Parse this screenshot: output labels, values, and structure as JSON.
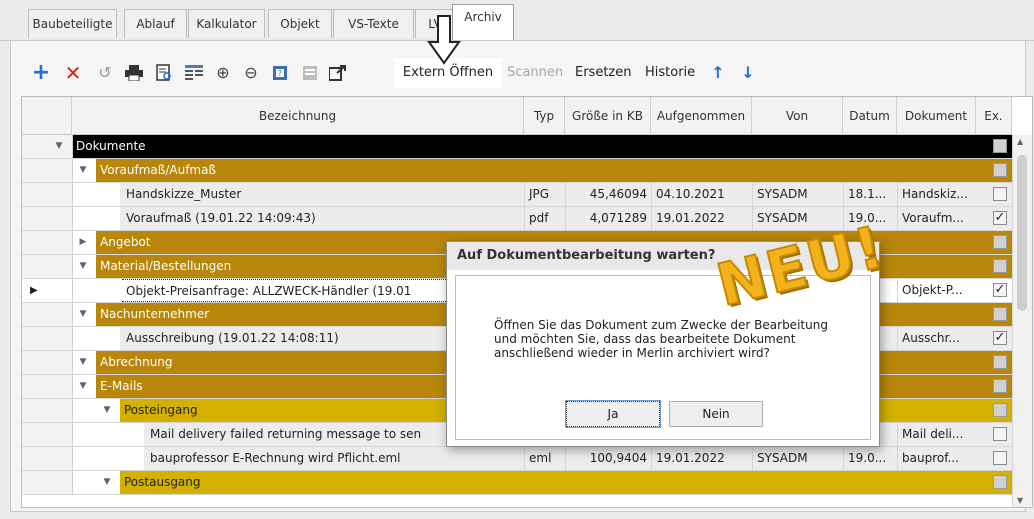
{
  "tabs": [
    {
      "label": "Baubeteiligte"
    },
    {
      "label": "Ablauf"
    },
    {
      "label": "Kalkulator"
    },
    {
      "label": "Objekt"
    },
    {
      "label": "VS-Texte"
    },
    {
      "label": "LV"
    },
    {
      "label": "Archiv",
      "active": true
    }
  ],
  "toolbar": {
    "extern_label": "Extern Öffnen",
    "scannen_label": "Scannen",
    "ersetzen_label": "Ersetzen",
    "historie_label": "Historie",
    "icons": [
      "add-icon",
      "delete-icon",
      "undo-icon",
      "print-icon",
      "preview-icon",
      "list-icon",
      "zoom-in-icon",
      "zoom-out-icon",
      "note-icon",
      "disabled-doc-icon",
      "export-icon",
      "move-up-icon",
      "move-down-icon"
    ]
  },
  "grid": {
    "columns": [
      "Bezeichnung",
      "Typ",
      "Größe in KB",
      "Aufgenommen",
      "Von",
      "Datum",
      "Dokument",
      "Ex."
    ],
    "rows": [
      {
        "label": "Dokumente",
        "level": 0,
        "kind": "root"
      },
      {
        "label": "Voraufmaß/Aufmaß",
        "level": 1,
        "kind": "group"
      },
      {
        "label": "Handskizze_Muster",
        "level": 2,
        "kind": "file",
        "typ": "JPG",
        "size": "45,46094",
        "aufgenommen": "04.10.2021",
        "von": "SYSADM",
        "datum": "18.1...",
        "dokument": "Handskiz...",
        "ex": false
      },
      {
        "label": "Voraufmaß (19.01.22 14:09:43)",
        "level": 2,
        "kind": "file",
        "typ": "pdf",
        "size": "4,071289",
        "aufgenommen": "19.01.2022",
        "von": "SYSADM",
        "datum": "19.0...",
        "dokument": "Voraufm...",
        "ex": true
      },
      {
        "label": "Angebot",
        "level": 1,
        "kind": "group",
        "collapsed": true
      },
      {
        "label": "Material/Bestellungen",
        "level": 1,
        "kind": "group"
      },
      {
        "label": "Objekt-Preisanfrage: ALLZWECK-Händler (19.01",
        "level": 2,
        "kind": "selected",
        "dokument": "Objekt-P...",
        "ex": true
      },
      {
        "label": "Nachunternehmer",
        "level": 1,
        "kind": "group"
      },
      {
        "label": "Ausschreibung (19.01.22 14:08:11)",
        "level": 2,
        "kind": "file",
        "dokument": "Ausschr...",
        "ex": true
      },
      {
        "label": "Abrechnung",
        "level": 1,
        "kind": "group"
      },
      {
        "label": "E-Mails",
        "level": 1,
        "kind": "group"
      },
      {
        "label": "Posteingang",
        "level": 2,
        "kind": "subgroup"
      },
      {
        "label": "Mail delivery failed returning message to sen",
        "level": 3,
        "kind": "file",
        "dokument": "Mail deli...",
        "ex": false
      },
      {
        "label": "bauprofessor E-Rechnung wird Pflicht.eml",
        "level": 3,
        "kind": "file",
        "typ": "eml",
        "size": "100,9404",
        "aufgenommen": "19.01.2022",
        "von": "SYSADM",
        "datum": "19.0...",
        "dokument": "bauprof...",
        "ex": false
      },
      {
        "label": "Postausgang",
        "level": 2,
        "kind": "subgroup"
      }
    ]
  },
  "dialog": {
    "title": "Auf Dokumentbearbeitung warten?",
    "line1": "Öffnen Sie das Dokument zum Zwecke der Bearbeitung",
    "line2": "und möchten Sie, dass das bearbeitete Dokument",
    "line3": "anschließend wieder in Merlin archiviert wird?",
    "yes_label": "Ja",
    "no_label": "Nein"
  },
  "badge": {
    "text": "NEU!"
  },
  "colors": {
    "group": "#b8860b",
    "subgroup": "#d4b000",
    "root": "#000000",
    "selected": "#ffffff",
    "add": "#1e6fd9",
    "delete": "#d9261c"
  }
}
